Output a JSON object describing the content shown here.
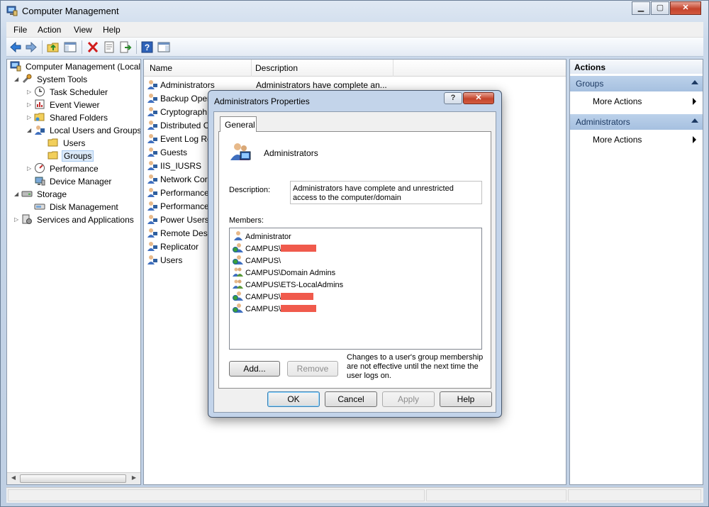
{
  "window": {
    "title": "Computer Management",
    "min_glyph": "▁",
    "max_glyph": "▢",
    "close_glyph": "✕"
  },
  "menu": [
    "File",
    "Action",
    "View",
    "Help"
  ],
  "tree": {
    "items": [
      {
        "label": "Computer Management (Local",
        "icon": "computer-management-icon"
      },
      {
        "label": "System Tools",
        "icon": "tools-icon"
      },
      {
        "label": "Task Scheduler",
        "icon": "clock-icon"
      },
      {
        "label": "Event Viewer",
        "icon": "event-viewer-icon"
      },
      {
        "label": "Shared Folders",
        "icon": "shared-folder-icon"
      },
      {
        "label": "Local Users and Groups",
        "icon": "users-icon"
      },
      {
        "label": "Users",
        "icon": "folder-icon"
      },
      {
        "label": "Groups",
        "icon": "folder-icon"
      },
      {
        "label": "Performance",
        "icon": "performance-icon"
      },
      {
        "label": "Device Manager",
        "icon": "device-manager-icon"
      },
      {
        "label": "Storage",
        "icon": "storage-icon"
      },
      {
        "label": "Disk Management",
        "icon": "disk-icon"
      },
      {
        "label": "Services and Applications",
        "icon": "services-icon"
      }
    ]
  },
  "list": {
    "columns": [
      "Name",
      "Description"
    ],
    "rows": [
      {
        "name": "Administrators",
        "description": "Administrators have complete an..."
      },
      {
        "name": "Backup Oper",
        "description": ""
      },
      {
        "name": "Cryptograph",
        "description": ""
      },
      {
        "name": "Distributed C",
        "description": ""
      },
      {
        "name": "Event Log Re",
        "description": ""
      },
      {
        "name": "Guests",
        "description": ""
      },
      {
        "name": "IIS_IUSRS",
        "description": ""
      },
      {
        "name": "Network Cor",
        "description": ""
      },
      {
        "name": "Performance",
        "description": ""
      },
      {
        "name": "Performance",
        "description": ""
      },
      {
        "name": "Power Users",
        "description": ""
      },
      {
        "name": "Remote Desk",
        "description": ""
      },
      {
        "name": "Replicator",
        "description": ""
      },
      {
        "name": "Users",
        "description": ""
      }
    ]
  },
  "actions": {
    "header": "Actions",
    "sections": [
      {
        "title": "Groups",
        "item": "More Actions"
      },
      {
        "title": "Administrators",
        "item": "More Actions"
      }
    ]
  },
  "dialog": {
    "title": "Administrators Properties",
    "help_glyph": "?",
    "close_glyph": "✕",
    "tab": "General",
    "group_name": "Administrators",
    "description_label": "Description:",
    "description_value": "Administrators have complete and unrestricted access to the computer/domain",
    "members_label": "Members:",
    "members": [
      {
        "label": "Administrator",
        "icon": "user-icon",
        "redacted": false
      },
      {
        "label": "CAMPUS\\",
        "icon": "domain-user-icon",
        "redacted": true
      },
      {
        "label": "CAMPUS\\",
        "icon": "domain-user-icon",
        "redacted": true
      },
      {
        "label": "CAMPUS\\Domain Admins",
        "icon": "domain-group-icon",
        "redacted": false
      },
      {
        "label": "CAMPUS\\ETS-LocalAdmins",
        "icon": "domain-group-icon",
        "redacted": false
      },
      {
        "label": "CAMPUS\\",
        "icon": "domain-user-icon",
        "redacted": true
      },
      {
        "label": "CAMPUS\\",
        "icon": "domain-user-icon",
        "redacted": true
      }
    ],
    "add_button": "Add...",
    "remove_button": "Remove",
    "note": "Changes to a user's group membership are not effective until the next time the user logs on.",
    "ok_button": "OK",
    "cancel_button": "Cancel",
    "apply_button": "Apply",
    "help_button": "Help"
  },
  "colors": {
    "redaction": "#f05a4c",
    "action_section": "#a6c0e0",
    "selection": "#dceaf9"
  }
}
